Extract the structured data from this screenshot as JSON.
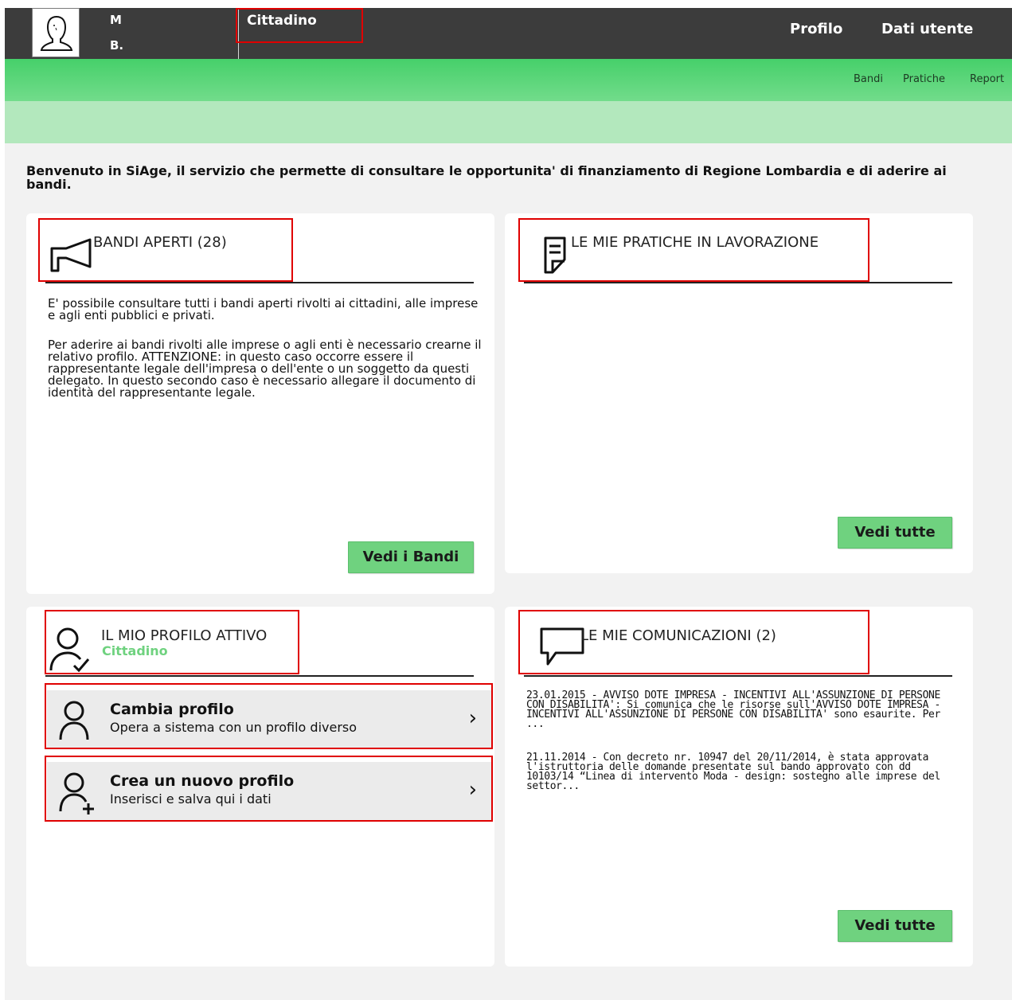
{
  "header": {
    "user_initial_1": "M",
    "user_initial_2": "B.",
    "role": "Cittadino",
    "nav": {
      "profilo": "Profilo",
      "dati_utente": "Dati utente"
    }
  },
  "subnav": {
    "bandi": "Bandi",
    "pratiche": "Pratiche",
    "report": "Report"
  },
  "welcome": "Benvenuto in SiAge, il servizio che permette di consultare le opportunita' di finanziamento di Regione Lombardia e di aderire ai bandi.",
  "bandi": {
    "title": "BANDI APERTI (28)",
    "text1": "E' possibile consultare tutti i bandi aperti rivolti ai cittadini, alle imprese e agli enti pubblici e privati.",
    "text2": "Per aderire ai bandi rivolti alle imprese o agli enti è necessario crearne il relativo profilo. ATTENZIONE: in questo caso occorre essere il rappresentante legale dell'impresa o dell'ente o un soggetto da questi delegato. In questo secondo caso è necessario allegare il documento di identità del rappresentante legale.",
    "button": "Vedi i Bandi"
  },
  "pratiche": {
    "title": "LE MIE PRATICHE IN LAVORAZIONE",
    "button": "Vedi tutte"
  },
  "profilo": {
    "title": "IL MIO PROFILO ATTIVO",
    "active": "Cittadino",
    "cambia": {
      "title": "Cambia profilo",
      "subtitle": "Opera a sistema con un profilo diverso"
    },
    "crea": {
      "title": "Crea un nuovo profilo",
      "subtitle": "Inserisci e salva qui i dati"
    }
  },
  "comunicazioni": {
    "title": "LE MIE COMUNICAZIONI (2)",
    "items": [
      "23.01.2015 - AVVISO DOTE IMPRESA - INCENTIVI ALL'ASSUNZIONE DI PERSONE CON DISABILITA': Si comunica che le risorse sull'AVVISO DOTE IMPRESA - INCENTIVI ALL'ASSUNZIONE DI PERSONE CON DISABILITA' sono esaurite. Per ...",
      "21.11.2014 - Con decreto nr. 10947 del 20/11/2014, è stata approvata l'istruttoria delle domande presentate sul bando approvato con dd 10103/14 “Linea di intervento Moda - design: sostegno alle imprese del settor..."
    ],
    "button": "Vedi tutte"
  },
  "colors": {
    "topbar": "#3c3c3c",
    "green": "#46d06a",
    "light_green": "#b3e8bd",
    "button_green": "#6fd27f",
    "highlight_red": "#e00000"
  }
}
